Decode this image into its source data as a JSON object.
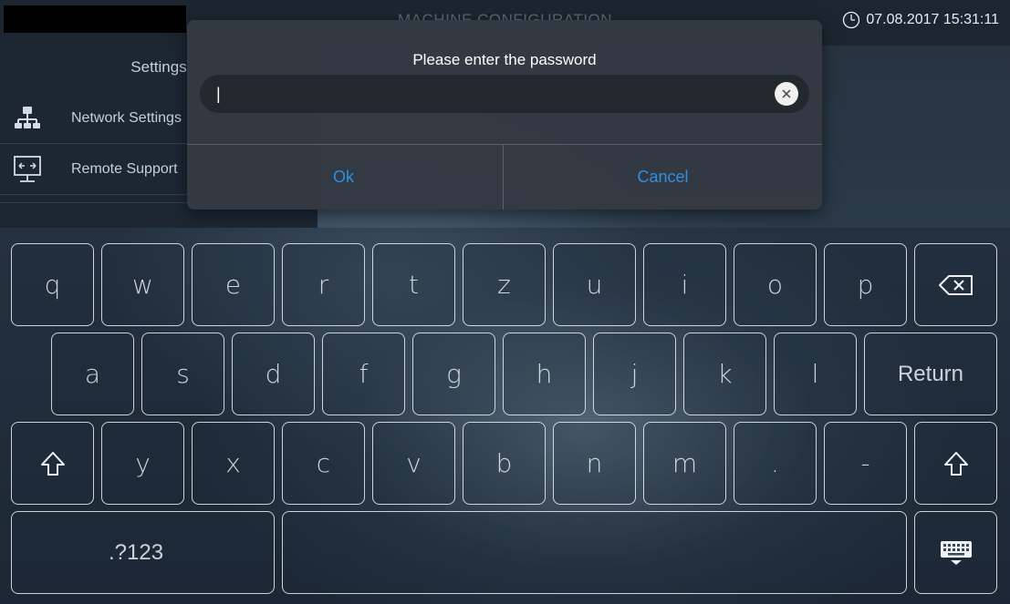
{
  "app": {
    "title": "MACHINE CONFIGURATION",
    "datetime": "07.08.2017 15:31:11"
  },
  "sidebar": {
    "heading": "Settings",
    "items": [
      {
        "label": "Network Settings",
        "icon": "network-icon"
      },
      {
        "label": "Remote Support",
        "icon": "remote-support-icon"
      }
    ]
  },
  "dialog": {
    "title": "Please enter the password",
    "input_value": "|",
    "ok_label": "Ok",
    "cancel_label": "Cancel",
    "accent": "#2f8fe0"
  },
  "keyboard": {
    "row1": [
      "q",
      "w",
      "e",
      "r",
      "t",
      "z",
      "u",
      "i",
      "o",
      "p"
    ],
    "row2": [
      "a",
      "s",
      "d",
      "f",
      "g",
      "h",
      "j",
      "k",
      "l"
    ],
    "return_label": "Return",
    "row3": [
      "y",
      "x",
      "c",
      "v",
      "b",
      "n",
      "m",
      ".",
      "-"
    ],
    "numbers_label": ".?123",
    "icons": [
      "backspace-icon",
      "shift-icon",
      "hide-keyboard-icon"
    ]
  }
}
